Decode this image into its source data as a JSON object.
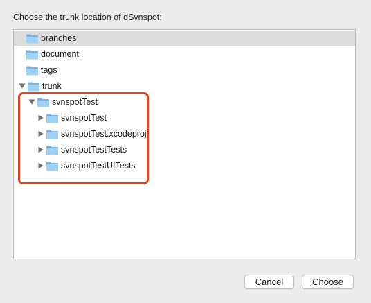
{
  "prompt": "Choose the trunk location of dSvnspot:",
  "tree": {
    "items": [
      {
        "label": "branches",
        "expanded": false,
        "has_children": false,
        "selected": true
      },
      {
        "label": "document",
        "expanded": false,
        "has_children": false,
        "selected": false
      },
      {
        "label": "tags",
        "expanded": false,
        "has_children": false,
        "selected": false
      },
      {
        "label": "trunk",
        "expanded": true,
        "has_children": true,
        "selected": false
      },
      {
        "label": "svnspotTest",
        "expanded": true,
        "has_children": true,
        "selected": false
      },
      {
        "label": "svnspotTest",
        "expanded": false,
        "has_children": true,
        "selected": false
      },
      {
        "label": "svnspotTest.xcodeproj",
        "expanded": false,
        "has_children": true,
        "selected": false
      },
      {
        "label": "svnspotTestTests",
        "expanded": false,
        "has_children": true,
        "selected": false
      },
      {
        "label": "svnspotTestUITests",
        "expanded": false,
        "has_children": true,
        "selected": false
      }
    ]
  },
  "buttons": {
    "cancel": "Cancel",
    "choose": "Choose"
  },
  "colors": {
    "highlight_border": "#e0451f",
    "folder_fill": "#8fc7f2",
    "selection": "#dcdcdc"
  }
}
